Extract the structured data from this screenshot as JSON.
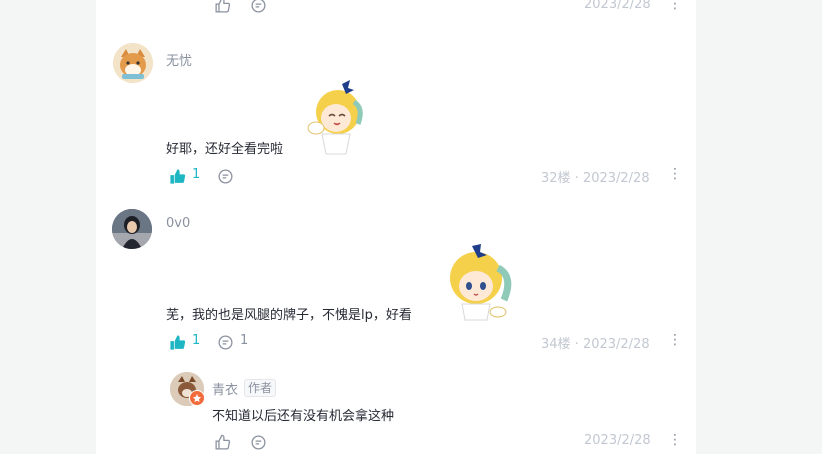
{
  "colors": {
    "accent": "#1fb6c3",
    "muted": "#8a919f",
    "light": "#c2c8d1",
    "text": "#252933"
  },
  "comments": [
    {
      "meta": "2023/2/28"
    },
    {
      "user": "无忧",
      "text": "好耶，还好全看完啦",
      "likes": "1",
      "meta": "32楼 · 2023/2/28"
    },
    {
      "user": "0v0",
      "text": "芜，我的也是风腿的牌子，不愧是lp，好看",
      "likes": "1",
      "replies": "1",
      "meta": "34楼 · 2023/2/28"
    }
  ],
  "reply": {
    "user": "青衣",
    "badge": "作者",
    "text": "不知道以后还有没有机会拿这种",
    "meta": "2023/2/28"
  },
  "more_glyph": "⋮"
}
